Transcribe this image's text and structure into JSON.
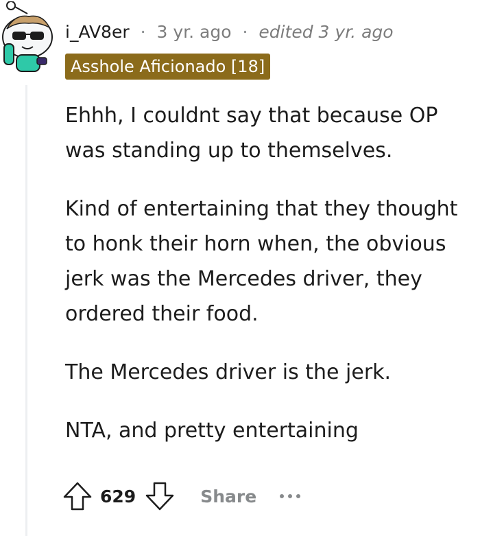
{
  "comment": {
    "username": "i_AV8er",
    "separator": "·",
    "time": "3 yr. ago",
    "edited": "edited 3 yr. ago",
    "flair": "Asshole Aficionado [18]",
    "paragraphs": [
      "Ehhh, I couldnt say that because OP was standing up to themselves.",
      "Kind of entertaining that they thought to honk their horn when, the obvious jerk was the Mercedes driver, they ordered their food.",
      "The Mercedes driver is the jerk.",
      "NTA, and pretty entertaining"
    ],
    "actions": {
      "score": "629",
      "share_label": "Share",
      "upvote_icon": "upvote-arrow-icon",
      "downvote_icon": "downvote-arrow-icon",
      "more_icon": "more-options-icon"
    },
    "colors": {
      "flair_bg": "#8b6b1b",
      "muted": "#878a8c",
      "text": "#1c1c1c"
    }
  }
}
